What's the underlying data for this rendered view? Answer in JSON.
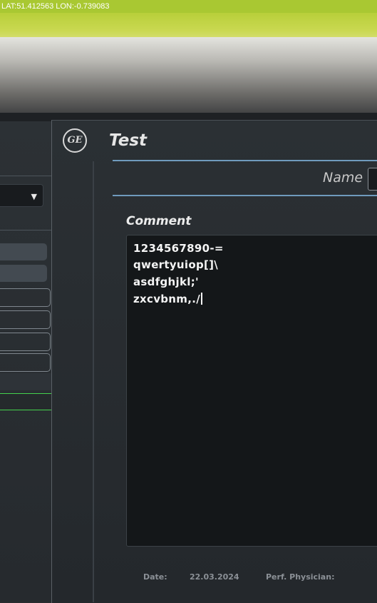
{
  "gps_overlay": "LAT:51.412563 LON:-0.739083",
  "dialog": {
    "title": "Test",
    "logo_text": "GE",
    "name_label": "Name",
    "name_value": "",
    "comment_label": "Comment",
    "comment_lines": [
      "1234567890-=",
      "qwertyuiop[]\\",
      "asdfghjkl;'",
      "zxcvbnm,./"
    ]
  },
  "footer": {
    "date_label": "Date:",
    "date_value": "22.03.2024",
    "physician_label": "Perf. Physician:"
  },
  "colors": {
    "overlay_green": "#a9c832",
    "accent_blue_line": "#6f9bbd",
    "selected_green": "#44d24c"
  }
}
